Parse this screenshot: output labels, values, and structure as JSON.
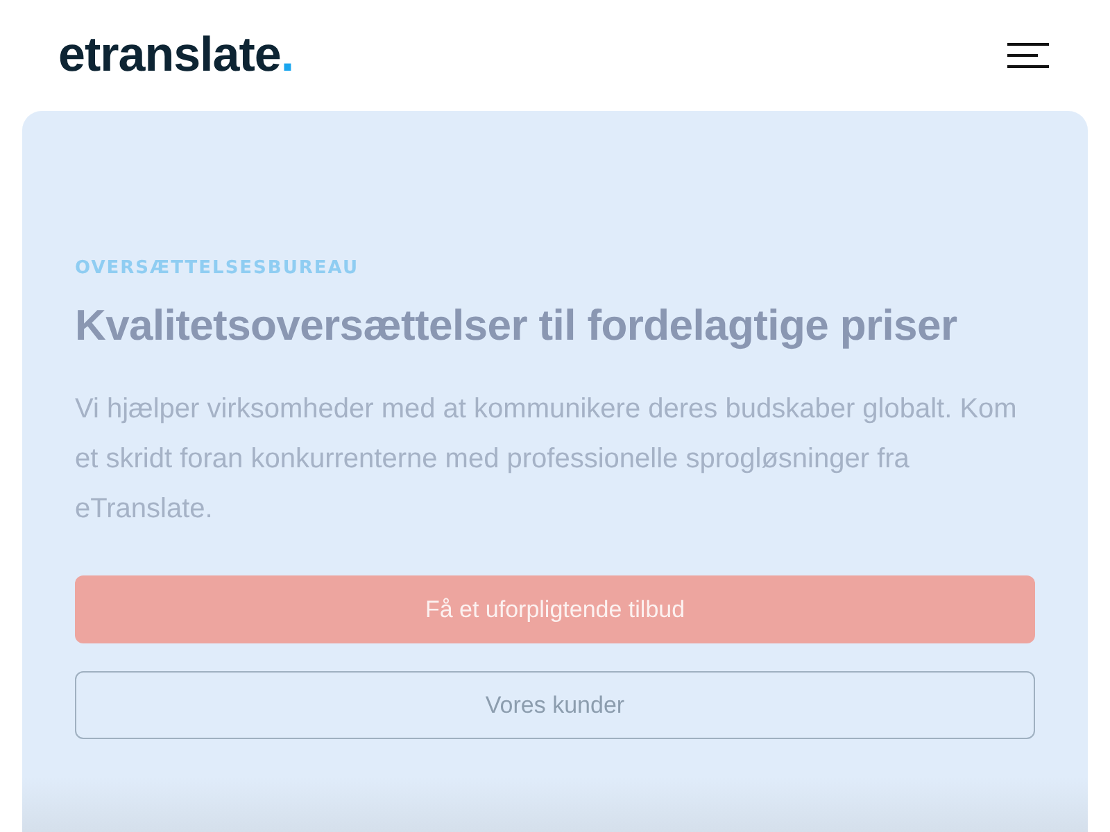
{
  "header": {
    "logo": {
      "text": "etranslate",
      "dot": "."
    }
  },
  "hero": {
    "eyebrow": "OVERSÆTTELSESBUREAU",
    "title": "Kvalitetsoversættelser til fordelagtige priser",
    "body": "Vi hjælper virksomheder med at kommunikere deres budskaber globalt. Kom et skridt foran konkurrenterne med professionelle sprogløsninger fra eTranslate.",
    "buttons": [
      {
        "label": "Få et uforpligtende tilbud",
        "kind": "primary"
      },
      {
        "label": "Vores kunder",
        "kind": "outline"
      }
    ]
  }
}
